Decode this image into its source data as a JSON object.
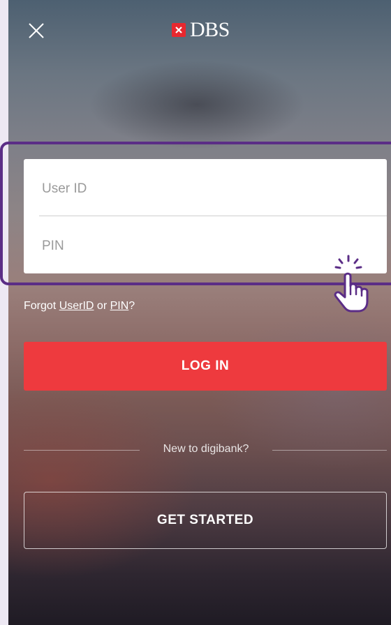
{
  "header": {
    "close_icon": "close-icon",
    "brand": "DBS",
    "brand_color": "#e8282f"
  },
  "login_form": {
    "userid": {
      "placeholder": "User ID",
      "value": ""
    },
    "pin": {
      "placeholder": "PIN",
      "value": ""
    }
  },
  "highlight": {
    "color": "#5b2d86",
    "cursor_icon": "tap-hand-icon"
  },
  "forgot": {
    "prefix": "Forgot ",
    "userid_link": "UserID",
    "middle": " or ",
    "pin_link": "PIN",
    "suffix": "?"
  },
  "actions": {
    "login_label": "LOG IN",
    "login_color": "#ee3a3e",
    "new_to_label": "New to digibank?",
    "get_started_label": "GET STARTED"
  }
}
